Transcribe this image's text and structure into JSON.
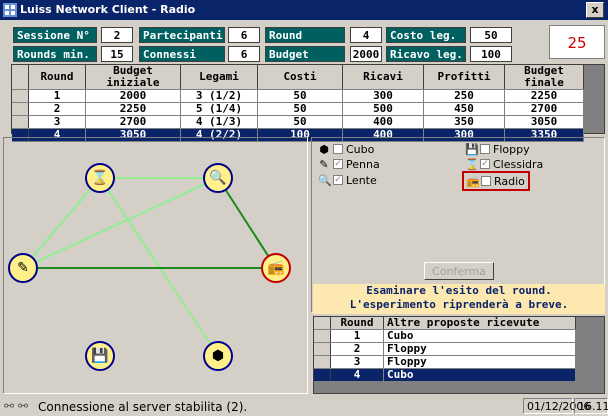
{
  "window": {
    "title": "Luiss Network Client - Radio",
    "close_label": "x"
  },
  "header": {
    "row1": [
      {
        "label": "Sessione N°",
        "value": "2"
      },
      {
        "label": "Partecipanti",
        "value": "6"
      },
      {
        "label": "Round",
        "value": "4"
      },
      {
        "label": "Costo leg.",
        "value": "50"
      }
    ],
    "row2": [
      {
        "label": "Rounds min.",
        "value": "15"
      },
      {
        "label": "Connessi",
        "value": "6"
      },
      {
        "label": "Budget",
        "value": "2000"
      },
      {
        "label": "Ricavo leg.",
        "value": "100"
      }
    ],
    "big_value": "25"
  },
  "rounds_table": {
    "columns": [
      "Round",
      "Budget iniziale",
      "Legami",
      "Costi",
      "Ricavi",
      "Profitti",
      "Budget finale"
    ],
    "rows": [
      [
        "1",
        "2000",
        "3 (1/2)",
        "50",
        "300",
        "250",
        "2250"
      ],
      [
        "2",
        "2250",
        "5 (1/4)",
        "50",
        "500",
        "450",
        "2700"
      ],
      [
        "3",
        "2700",
        "4 (1/3)",
        "50",
        "400",
        "350",
        "3050"
      ],
      [
        "4",
        "3050",
        "4 (2/2)",
        "100",
        "400",
        "300",
        "3350"
      ]
    ],
    "selected_row": 3
  },
  "network": {
    "nodes": [
      {
        "name": "clessidra",
        "icon": "hourglass-icon",
        "glyph": "⌛"
      },
      {
        "name": "lente",
        "icon": "magnifier-icon",
        "glyph": "🔍"
      },
      {
        "name": "penna",
        "icon": "pen-icon",
        "glyph": "✎"
      },
      {
        "name": "radio",
        "icon": "radio-icon",
        "glyph": "📻"
      },
      {
        "name": "floppy",
        "icon": "floppy-icon",
        "glyph": "💾"
      },
      {
        "name": "cubo",
        "icon": "cube-icon",
        "glyph": "⬢"
      }
    ],
    "colors": {
      "light_link": "#90ee90",
      "dark_link": "#1a8a1a",
      "node_fill": "#fff08a",
      "node_border": "#00008b",
      "self_border": "#c00000"
    }
  },
  "options": [
    {
      "label": "Cubo",
      "icon": "cube-icon",
      "glyph": "⬢",
      "checked": false
    },
    {
      "label": "Floppy",
      "icon": "floppy-icon",
      "glyph": "💾",
      "checked": false
    },
    {
      "label": "Penna",
      "icon": "pen-icon",
      "glyph": "✎",
      "checked": true
    },
    {
      "label": "Clessidra",
      "icon": "hourglass-icon",
      "glyph": "⌛",
      "checked": true
    },
    {
      "label": "Lente",
      "icon": "magnifier-icon",
      "glyph": "🔍",
      "checked": true
    },
    {
      "label": "Radio",
      "icon": "radio-icon",
      "glyph": "📻",
      "checked": false
    }
  ],
  "confirm_label": "Conferma",
  "message": {
    "line1": "Esaminare l'esito del round.",
    "line2": "L'esperimento riprenderà a breve."
  },
  "proposals_table": {
    "columns": [
      "Round",
      "Altre proposte ricevute"
    ],
    "rows": [
      [
        "1",
        "Cubo"
      ],
      [
        "2",
        "Floppy"
      ],
      [
        "3",
        "Floppy"
      ],
      [
        "4",
        "Cubo"
      ]
    ],
    "selected_row": 3
  },
  "status": {
    "text": "Connessione al server stabilita (2).",
    "date": "01/12/2006",
    "time": "16.11"
  }
}
